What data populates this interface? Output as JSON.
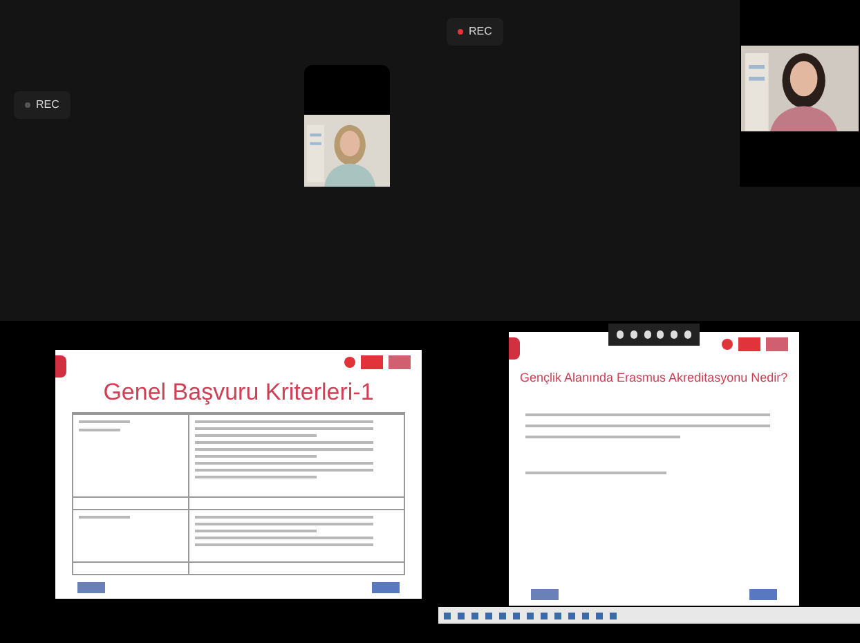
{
  "tiles": [
    {
      "kind": "camera",
      "rec": {
        "label": "REC",
        "recording": false
      }
    },
    {
      "kind": "camera",
      "rec": {
        "label": "REC",
        "recording": true
      }
    },
    {
      "kind": "table_slide",
      "title": "Genel Başvuru Kriterleri-1"
    },
    {
      "kind": "bullet_slide",
      "title": "Gençlik Alanında Erasmus Akreditasyonu Nedir?",
      "screen_share": true
    }
  ]
}
